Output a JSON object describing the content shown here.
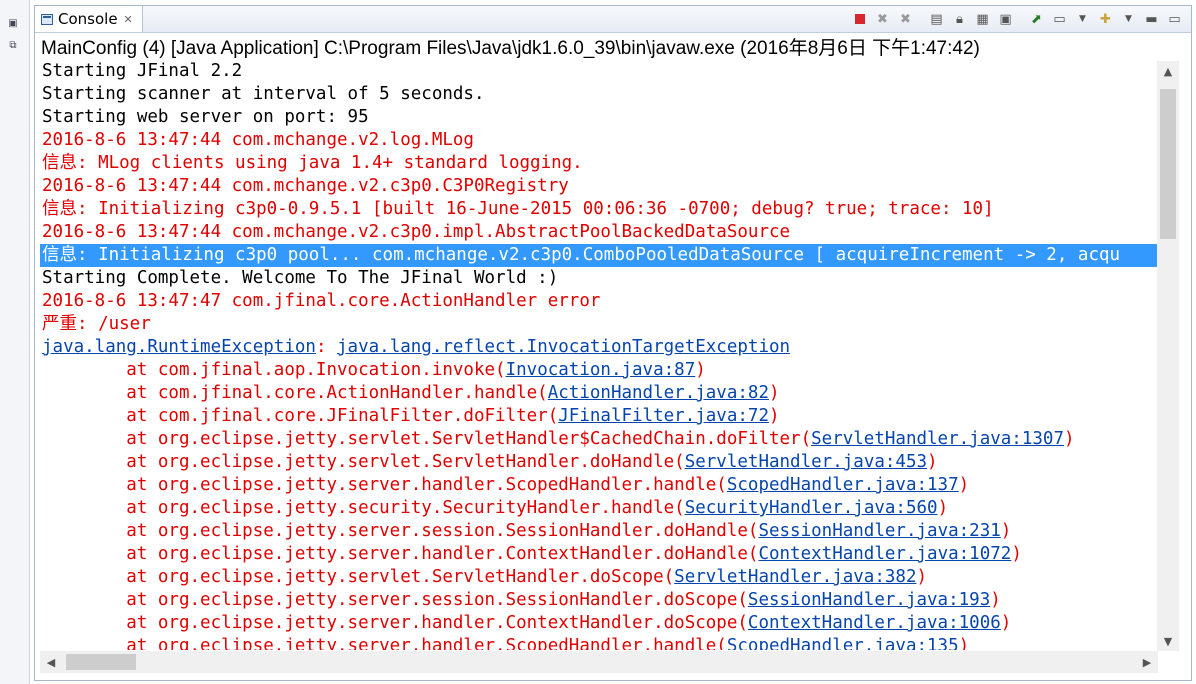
{
  "tab": {
    "label": "Console",
    "close": "✕"
  },
  "description": "MainConfig (4) [Java Application] C:\\Program Files\\Java\\jdk1.6.0_39\\bin\\javaw.exe (2016年8月6日 下午1:47:42)",
  "lines": [
    {
      "type": "out",
      "text": "Starting JFinal 2.2"
    },
    {
      "type": "out",
      "text": "Starting scanner at interval of 5 seconds."
    },
    {
      "type": "out",
      "text": "Starting web server on port: 95"
    },
    {
      "type": "err",
      "text": "2016-8-6 13:47:44 com.mchange.v2.log.MLog"
    },
    {
      "type": "err",
      "text": "信息: MLog clients using java 1.4+ standard logging."
    },
    {
      "type": "err",
      "text": "2016-8-6 13:47:44 com.mchange.v2.c3p0.C3P0Registry"
    },
    {
      "type": "err",
      "text": "信息: Initializing c3p0-0.9.5.1 [built 16-June-2015 00:06:36 -0700; debug? true; trace: 10]"
    },
    {
      "type": "err",
      "text": "2016-8-6 13:47:44 com.mchange.v2.c3p0.impl.AbstractPoolBackedDataSource"
    },
    {
      "type": "selected",
      "text": "信息: Initializing c3p0 pool... com.mchange.v2.c3p0.ComboPooledDataSource [ acquireIncrement -> 2, acqu"
    },
    {
      "type": "out",
      "text": "Starting Complete. Welcome To The JFinal World :)"
    },
    {
      "type": "err",
      "text": "2016-8-6 13:47:47 com.jfinal.core.ActionHandler error"
    },
    {
      "type": "err",
      "text": "严重: /user"
    }
  ],
  "exception": {
    "class": "java.lang.RuntimeException",
    "sep": ": ",
    "cause": "java.lang.reflect.InvocationTargetException"
  },
  "stack": [
    {
      "prefix": "\tat com.jfinal.aop.Invocation.invoke(",
      "link": "Invocation.java:87",
      "suffix": ")"
    },
    {
      "prefix": "\tat com.jfinal.core.ActionHandler.handle(",
      "link": "ActionHandler.java:82",
      "suffix": ")"
    },
    {
      "prefix": "\tat com.jfinal.core.JFinalFilter.doFilter(",
      "link": "JFinalFilter.java:72",
      "suffix": ")"
    },
    {
      "prefix": "\tat org.eclipse.jetty.servlet.ServletHandler$CachedChain.doFilter(",
      "link": "ServletHandler.java:1307",
      "suffix": ")"
    },
    {
      "prefix": "\tat org.eclipse.jetty.servlet.ServletHandler.doHandle(",
      "link": "ServletHandler.java:453",
      "suffix": ")"
    },
    {
      "prefix": "\tat org.eclipse.jetty.server.handler.ScopedHandler.handle(",
      "link": "ScopedHandler.java:137",
      "suffix": ")"
    },
    {
      "prefix": "\tat org.eclipse.jetty.security.SecurityHandler.handle(",
      "link": "SecurityHandler.java:560",
      "suffix": ")"
    },
    {
      "prefix": "\tat org.eclipse.jetty.server.session.SessionHandler.doHandle(",
      "link": "SessionHandler.java:231",
      "suffix": ")"
    },
    {
      "prefix": "\tat org.eclipse.jetty.server.handler.ContextHandler.doHandle(",
      "link": "ContextHandler.java:1072",
      "suffix": ")"
    },
    {
      "prefix": "\tat org.eclipse.jetty.servlet.ServletHandler.doScope(",
      "link": "ServletHandler.java:382",
      "suffix": ")"
    },
    {
      "prefix": "\tat org.eclipse.jetty.server.session.SessionHandler.doScope(",
      "link": "SessionHandler.java:193",
      "suffix": ")"
    },
    {
      "prefix": "\tat org.eclipse.jetty.server.handler.ContextHandler.doScope(",
      "link": "ContextHandler.java:1006",
      "suffix": ")"
    },
    {
      "prefix": "\tat org.eclipse.jetty.server.handler.ScopedHandler.handle(",
      "link": "ScopedHandler.java:135",
      "suffix": ")"
    }
  ],
  "toolbar": [
    "terminate-icon",
    "remove-launch-icon",
    "remove-all-terminated-icon",
    "clear-console-icon",
    "scroll-lock-icon",
    "word-wrap-icon",
    "show-stdout-icon",
    "show-stderr-icon",
    "pin-console-icon",
    "display-selected-console-icon",
    "open-console-icon",
    "view-menu-icon",
    "minimize-icon",
    "maximize-icon"
  ],
  "colors": {
    "stdout": "#000000",
    "stderr": "#e00000",
    "link": "#0645ad",
    "selection": "#3399ff"
  }
}
